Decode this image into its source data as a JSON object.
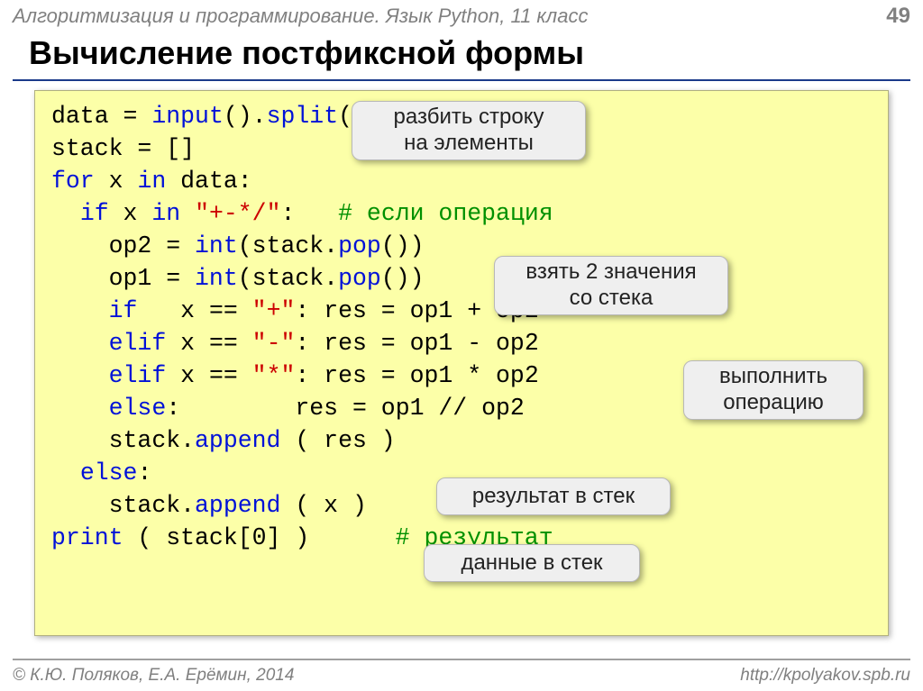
{
  "header": {
    "title": "Алгоритмизация и программирование. Язык Python, 11 класс",
    "page": "49"
  },
  "title": "Вычисление постфиксной формы",
  "code": {
    "l1a": "data",
    "l1eq": " = ",
    "l1_input": "input",
    "l1p1": "().",
    "l1_split": "split",
    "l1p2": "()",
    "l2": "stack = []",
    "l3_for": "for",
    "l3_mid": " x ",
    "l3_in": "in",
    "l3_tail": " data:",
    "l4_pad": "  ",
    "l4_if": "if",
    "l4_mid": " x ",
    "l4_in": "in",
    "l4_sp": " ",
    "l4_str": "\"+-*/\"",
    "l4_colon": ":   ",
    "l4_cmt": "# если операция",
    "l5_pad": "    op2 = ",
    "l5_int": "int",
    "l5_mid": "(stack.",
    "l5_pop": "pop",
    "l5_end": "())",
    "l6_pad": "    op1 = ",
    "l6_int": "int",
    "l6_mid": "(stack.",
    "l6_pop": "pop",
    "l6_end": "())",
    "l7_pad": "    ",
    "l7_if": "if",
    "l7_mid": "   x == ",
    "l7_str": "\"+\"",
    "l7_tail": ": res = op1 + op2",
    "l8_pad": "    ",
    "l8_elif": "elif",
    "l8_mid": " x == ",
    "l8_str": "\"-\"",
    "l8_tail": ": res = op1 - op2",
    "l9_pad": "    ",
    "l9_elif": "elif",
    "l9_mid": " x == ",
    "l9_str": "\"*\"",
    "l9_tail": ": res = op1 * op2",
    "l10_pad": "    ",
    "l10_else": "else",
    "l10_tail": ":        res = op1 // op2",
    "l11_pad": "    stack.",
    "l11_append": "append",
    "l11_tail": " ( res )",
    "l12_pad": "  ",
    "l12_else": "else",
    "l12_colon": ":",
    "l13_pad": "    stack.",
    "l13_append": "append",
    "l13_tail": " ( x )",
    "l14_print": "print",
    "l14_mid": " ( stack[0] )      ",
    "l14_cmt": "# результат"
  },
  "callouts": {
    "c1": "разбить строку\nна элементы",
    "c2": "взять 2 значения\nсо стека",
    "c3": "выполнить\nоперацию",
    "c4": "результат в стек",
    "c5": "данные в стек"
  },
  "footer": {
    "left": "© К.Ю. Поляков, Е.А. Ерёмин, 2014",
    "right": "http://kpolyakov.spb.ru"
  }
}
